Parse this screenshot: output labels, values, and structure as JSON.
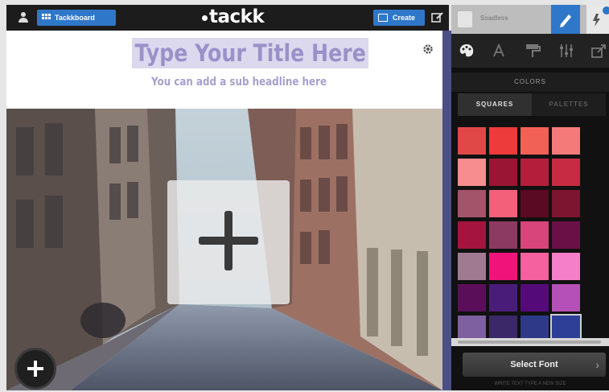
{
  "topbar": {
    "dashboard_label": "Tackkboard",
    "logo": "tackk",
    "create_label": "Create"
  },
  "page": {
    "title_placeholder": "Type Your Title Here",
    "subtitle_placeholder": "You can add a sub headline here"
  },
  "panel": {
    "user_name": "Ssadless",
    "section_title": "COLORS",
    "tabs": [
      {
        "label": "SQUARES",
        "active": true
      },
      {
        "label": "PALETTES",
        "active": false
      }
    ],
    "tools": [
      "palette-icon",
      "font-icon",
      "paint-roller-icon",
      "sliders-icon",
      "share-icon"
    ],
    "swatches": [
      "#e04848",
      "#ed3a3a",
      "#f26155",
      "#f47a7a",
      "#f78d8f",
      "#9a1533",
      "#b51e3a",
      "#c72b44",
      "#a4546a",
      "#f2607a",
      "#5a0a22",
      "#7d1530",
      "#a4143e",
      "#8c3a62",
      "#d8457a",
      "#6b1046",
      "#a07a90",
      "#f0147a",
      "#f5609e",
      "#f57fc8",
      "#5a0e5a",
      "#4a1c7a",
      "#550a7a",
      "#b550b8",
      "#7e60a0",
      "#3a2868",
      "#2e3a88",
      "#2e3f97"
    ],
    "selected_swatch_index": 27,
    "select_font_label": "Select Font",
    "footer_text": "WRITE TEXT TYPE A NEW SIZE"
  },
  "colors": {
    "accent": "#2f78c9",
    "title_color": "#9a91c9",
    "divider": "#4a4f86"
  }
}
